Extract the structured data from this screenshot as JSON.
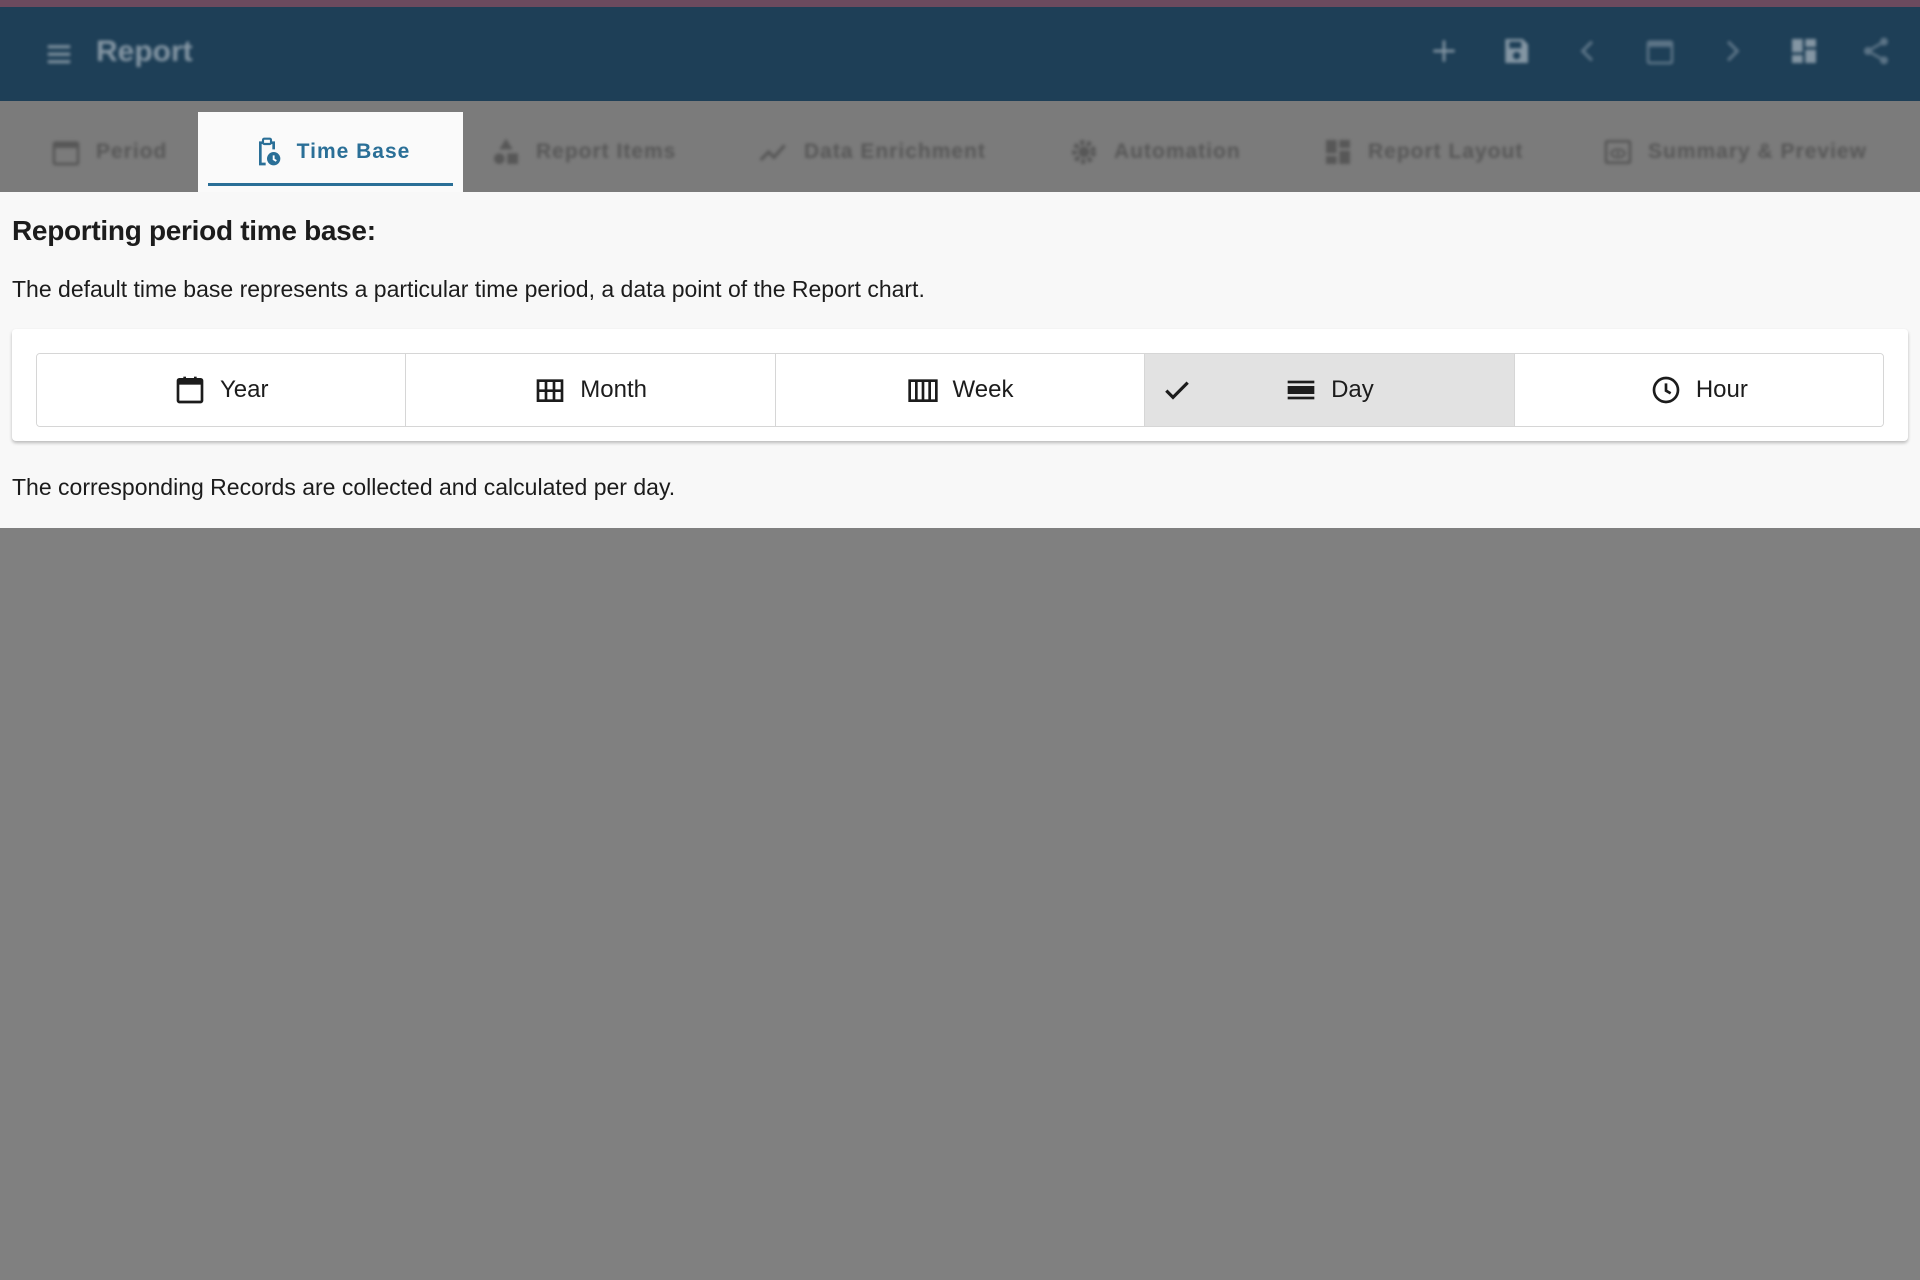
{
  "appbar": {
    "title": "Report",
    "actions": [
      {
        "icon": "plus-icon"
      },
      {
        "icon": "save-icon"
      },
      {
        "icon": "chevron-left-icon"
      },
      {
        "icon": "calendar-icon"
      },
      {
        "icon": "chevron-right-icon"
      },
      {
        "icon": "dashboard-icon"
      },
      {
        "icon": "share-icon"
      }
    ]
  },
  "tabs": {
    "period": "Period",
    "time_base": "Time Base",
    "report_items": "Report Items",
    "data_enrichment": "Data Enrichment",
    "automation": "Automation",
    "report_layout": "Report Layout",
    "summary_preview": "Summary & Preview",
    "active": "Time Base"
  },
  "content": {
    "heading": "Reporting period time base:",
    "description": "The default time base represents a particular time period, a data point of the Report chart.",
    "note": "The corresponding Records are collected and calculated per day."
  },
  "time_base_options": {
    "year": "Year",
    "month": "Month",
    "week": "Week",
    "day": "Day",
    "hour": "Hour",
    "selected": "Day"
  },
  "colors": {
    "appbar": "#1e3f57",
    "accent": "#2a6f97",
    "overlay": "#808080",
    "selected_toggle": "#e2e2e2"
  }
}
